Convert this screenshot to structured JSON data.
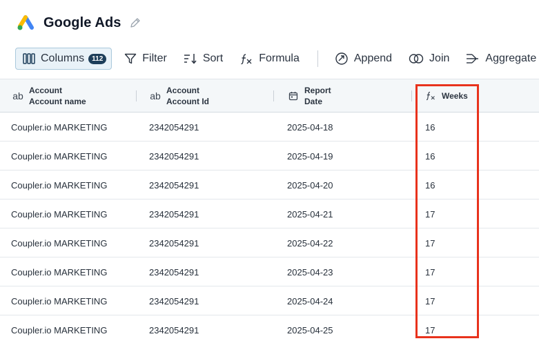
{
  "app": {
    "title": "Google Ads"
  },
  "toolbar": {
    "columns_label": "Columns",
    "columns_count": "112",
    "filter_label": "Filter",
    "sort_label": "Sort",
    "formula_label": "Formula",
    "append_label": "Append",
    "join_label": "Join",
    "aggregate_label": "Aggregate"
  },
  "columns": [
    {
      "line1": "Account",
      "line2": "Account name"
    },
    {
      "line1": "Account",
      "line2": "Account Id"
    },
    {
      "line1": "Report",
      "line2": "Date"
    },
    {
      "line1": "Weeks",
      "line2": ""
    }
  ],
  "rows": [
    {
      "name": "Coupler.io MARKETING",
      "id": "2342054291",
      "date": "2025-04-18",
      "weeks": "16"
    },
    {
      "name": "Coupler.io MARKETING",
      "id": "2342054291",
      "date": "2025-04-19",
      "weeks": "16"
    },
    {
      "name": "Coupler.io MARKETING",
      "id": "2342054291",
      "date": "2025-04-20",
      "weeks": "16"
    },
    {
      "name": "Coupler.io MARKETING",
      "id": "2342054291",
      "date": "2025-04-21",
      "weeks": "17"
    },
    {
      "name": "Coupler.io MARKETING",
      "id": "2342054291",
      "date": "2025-04-22",
      "weeks": "17"
    },
    {
      "name": "Coupler.io MARKETING",
      "id": "2342054291",
      "date": "2025-04-23",
      "weeks": "17"
    },
    {
      "name": "Coupler.io MARKETING",
      "id": "2342054291",
      "date": "2025-04-24",
      "weeks": "17"
    },
    {
      "name": "Coupler.io MARKETING",
      "id": "2342054291",
      "date": "2025-04-25",
      "weeks": "17"
    }
  ],
  "colors": {
    "accent": "#1d3e5a",
    "highlight": "#e8321c",
    "header_bg": "#f4f7f9"
  }
}
